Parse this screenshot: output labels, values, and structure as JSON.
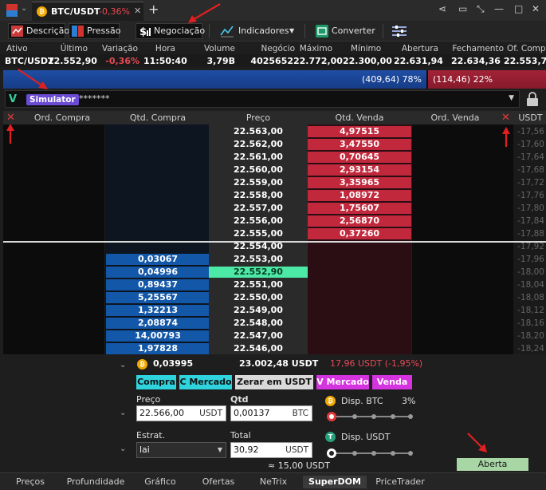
{
  "tab": {
    "symbol": "BTC/USDT",
    "change": "-0,36%",
    "coin_glyph": "₿"
  },
  "toolbar": {
    "descricao": "Descrição",
    "pressao": "Pressão",
    "negociacao": "Negociação",
    "indicadores": "Indicadores",
    "converter": "Converter"
  },
  "quote": {
    "headers": [
      "Ativo",
      "Último",
      "Variação",
      "Hora",
      "Volume",
      "Negócio",
      "Máximo",
      "Mínimo",
      "Abertura",
      "Fechamento A",
      "Of. Comp"
    ],
    "values": [
      "BTC/USDT",
      "22.552,90",
      "-0,36%",
      "11:50:40",
      "3,79B",
      "4025652",
      "22.772,00",
      "22.300,00",
      "22.631,94",
      "22.634,36",
      "22.553,7"
    ]
  },
  "pressure": {
    "buy": "(409,64) 78%",
    "sell": "(114,46) 22%",
    "buy_fraction": 0.78
  },
  "account": {
    "badge": "Simulator",
    "password": "*******"
  },
  "dom": {
    "headers": {
      "ord_compra": "Ord. Compra",
      "qtd_compra": "Qtd. Compra",
      "preco": "Preço",
      "qtd_venda": "Qtd. Venda",
      "ord_venda": "Ord. Venda",
      "usdt": "USDT"
    },
    "asks": [
      {
        "price": "22.563,00",
        "qty": "4,97515",
        "usdt": "-17,56"
      },
      {
        "price": "22.562,00",
        "qty": "3,47550",
        "usdt": "-17,60"
      },
      {
        "price": "22.561,00",
        "qty": "0,70645",
        "usdt": "-17,64"
      },
      {
        "price": "22.560,00",
        "qty": "2,93154",
        "usdt": "-17,68"
      },
      {
        "price": "22.559,00",
        "qty": "3,35965",
        "usdt": "-17,72"
      },
      {
        "price": "22.558,00",
        "qty": "1,08972",
        "usdt": "-17,76"
      },
      {
        "price": "22.557,00",
        "qty": "1,75607",
        "usdt": "-17,80"
      },
      {
        "price": "22.556,00",
        "qty": "2,56870",
        "usdt": "-17,84"
      },
      {
        "price": "22.555,00",
        "qty": "0,37260",
        "usdt": "-17,88"
      }
    ],
    "mid": [
      {
        "price": "22.554,00",
        "usdt": "-17,92"
      }
    ],
    "bids": [
      {
        "price": "22.553,00",
        "qty": "0,03067",
        "usdt": "-17,96"
      },
      {
        "price": "22.552,90",
        "qty": "0,04996",
        "usdt": "-18,00",
        "last": true
      },
      {
        "price": "22.551,00",
        "qty": "0,89437",
        "usdt": "-18,04"
      },
      {
        "price": "22.550,00",
        "qty": "5,25567",
        "usdt": "-18,08"
      },
      {
        "price": "22.549,00",
        "qty": "1,32213",
        "usdt": "-18,12"
      },
      {
        "price": "22.548,00",
        "qty": "2,08874",
        "usdt": "-18,16"
      },
      {
        "price": "22.547,00",
        "qty": "14,00793",
        "usdt": "-18,20"
      },
      {
        "price": "22.546,00",
        "qty": "1,97828",
        "usdt": "-18,24"
      }
    ]
  },
  "position": {
    "qty": "0,03995",
    "value": "23.002,48 USDT",
    "pnl": "17,96 USDT (-1,95%)"
  },
  "buttons": {
    "compra": "Compra",
    "c_mercado": "C Mercado",
    "zerar": "Zerar em USDT",
    "v_mercado": "V Mercado",
    "venda": "Venda"
  },
  "entry": {
    "preco_label": "Preço",
    "preco_value": "22.566,00",
    "preco_unit": "USDT",
    "qtd_label": "Qtd",
    "qtd_value": "0,00137",
    "qtd_unit": "BTC",
    "estrat_label": "Estrat.",
    "estrat_value": "lai",
    "total_label": "Total",
    "total_value": "30,92",
    "total_unit": "USDT",
    "approx": "≈ 15,00 USDT",
    "disp_btc_label": "Disp. BTC",
    "disp_btc_pct": "3%",
    "disp_usdt_label": "Disp. USDT",
    "status": "Aberta"
  },
  "bottom_tabs": [
    "Preços",
    "Profundidade",
    "Gráfico",
    "Ofertas",
    "NeTrix",
    "SuperDOM",
    "PriceTrader"
  ],
  "colors": {
    "ask": "#c2283c",
    "bid": "#1357a8",
    "last": "#4ce8a6",
    "negative": "#e84a55",
    "annotation": "#e02020"
  }
}
